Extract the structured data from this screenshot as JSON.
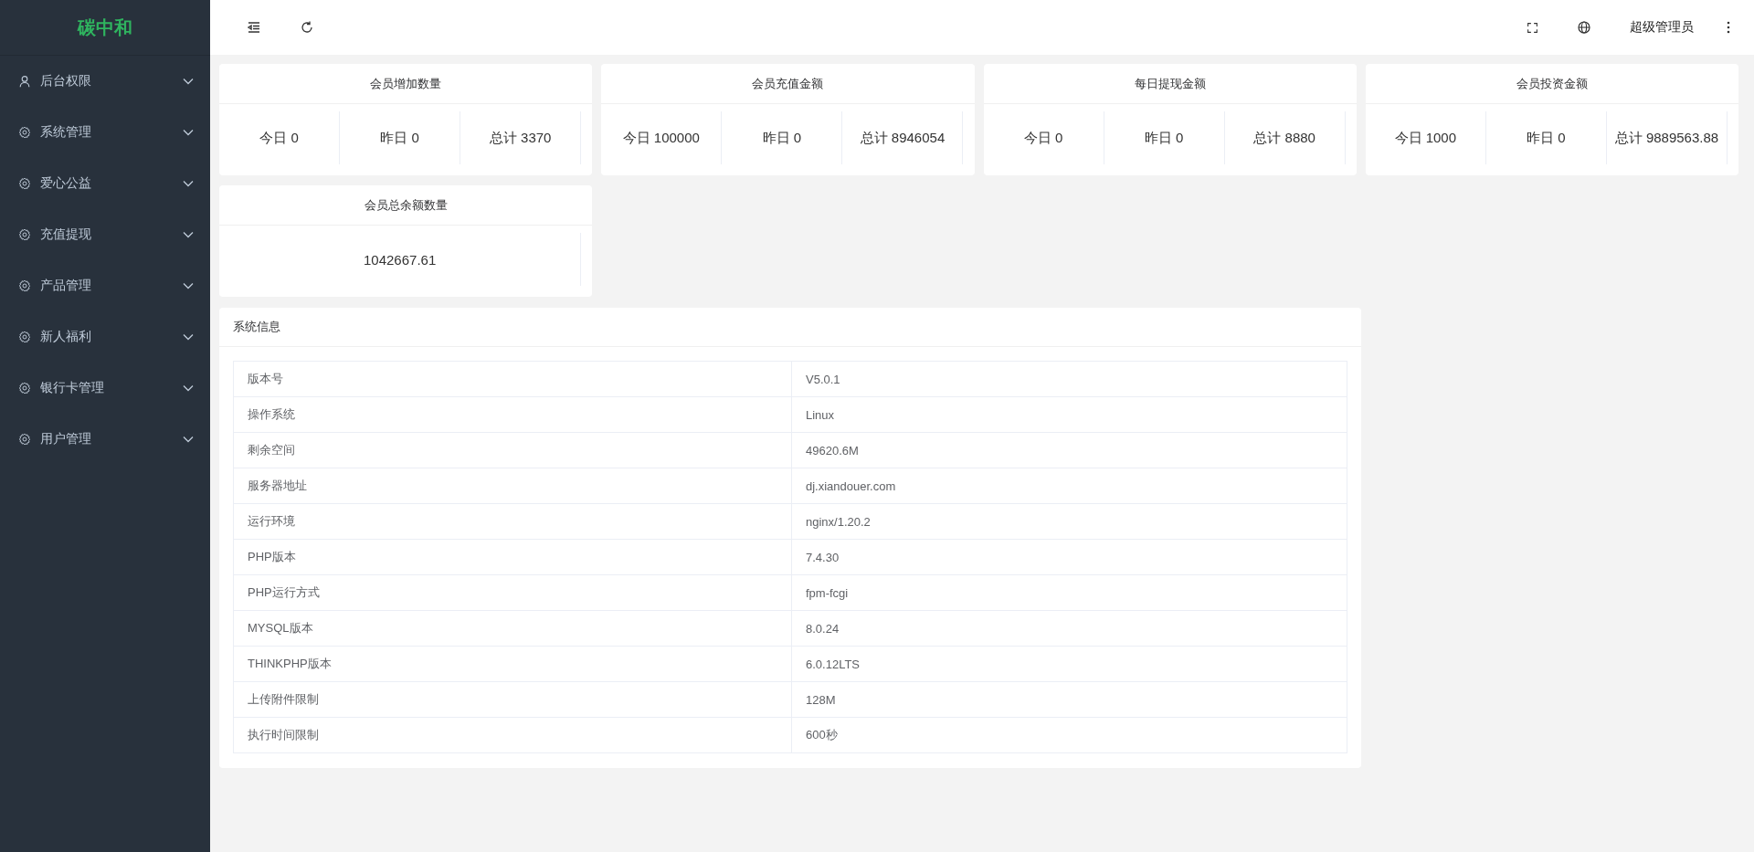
{
  "sidebar": {
    "logo": "碳中和",
    "items": [
      {
        "label": "后台权限"
      },
      {
        "label": "系统管理"
      },
      {
        "label": "爱心公益"
      },
      {
        "label": "充值提现"
      },
      {
        "label": "产品管理"
      },
      {
        "label": "新人福利"
      },
      {
        "label": "银行卡管理"
      },
      {
        "label": "用户管理"
      }
    ]
  },
  "header": {
    "user": "超级管理员"
  },
  "stat_cards": [
    {
      "title": "会员增加数量",
      "stats": [
        "今日 0",
        "昨日 0",
        "总计 3370"
      ]
    },
    {
      "title": "会员充值金额",
      "stats": [
        "今日 100000",
        "昨日 0",
        "总计 8946054"
      ]
    },
    {
      "title": "每日提现金额",
      "stats": [
        "今日 0",
        "昨日 0",
        "总计 8880"
      ]
    },
    {
      "title": "会员投资金额",
      "stats": [
        "今日 1000",
        "昨日 0",
        "总计 9889563.88"
      ]
    },
    {
      "title": "会员总余额数量",
      "stats": [
        "1042667.61"
      ]
    }
  ],
  "system_info": {
    "title": "系统信息",
    "rows": [
      {
        "label": "版本号",
        "value": "V5.0.1"
      },
      {
        "label": "操作系统",
        "value": "Linux"
      },
      {
        "label": "剩余空间",
        "value": "49620.6M"
      },
      {
        "label": "服务器地址",
        "value": "dj.xiandouer.com"
      },
      {
        "label": "运行环境",
        "value": "nginx/1.20.2"
      },
      {
        "label": "PHP版本",
        "value": "7.4.30"
      },
      {
        "label": "PHP运行方式",
        "value": "fpm-fcgi"
      },
      {
        "label": "MYSQL版本",
        "value": "8.0.24"
      },
      {
        "label": "THINKPHP版本",
        "value": "6.0.12LTS"
      },
      {
        "label": "上传附件限制",
        "value": "128M"
      },
      {
        "label": "执行时间限制",
        "value": "600秒"
      }
    ]
  }
}
